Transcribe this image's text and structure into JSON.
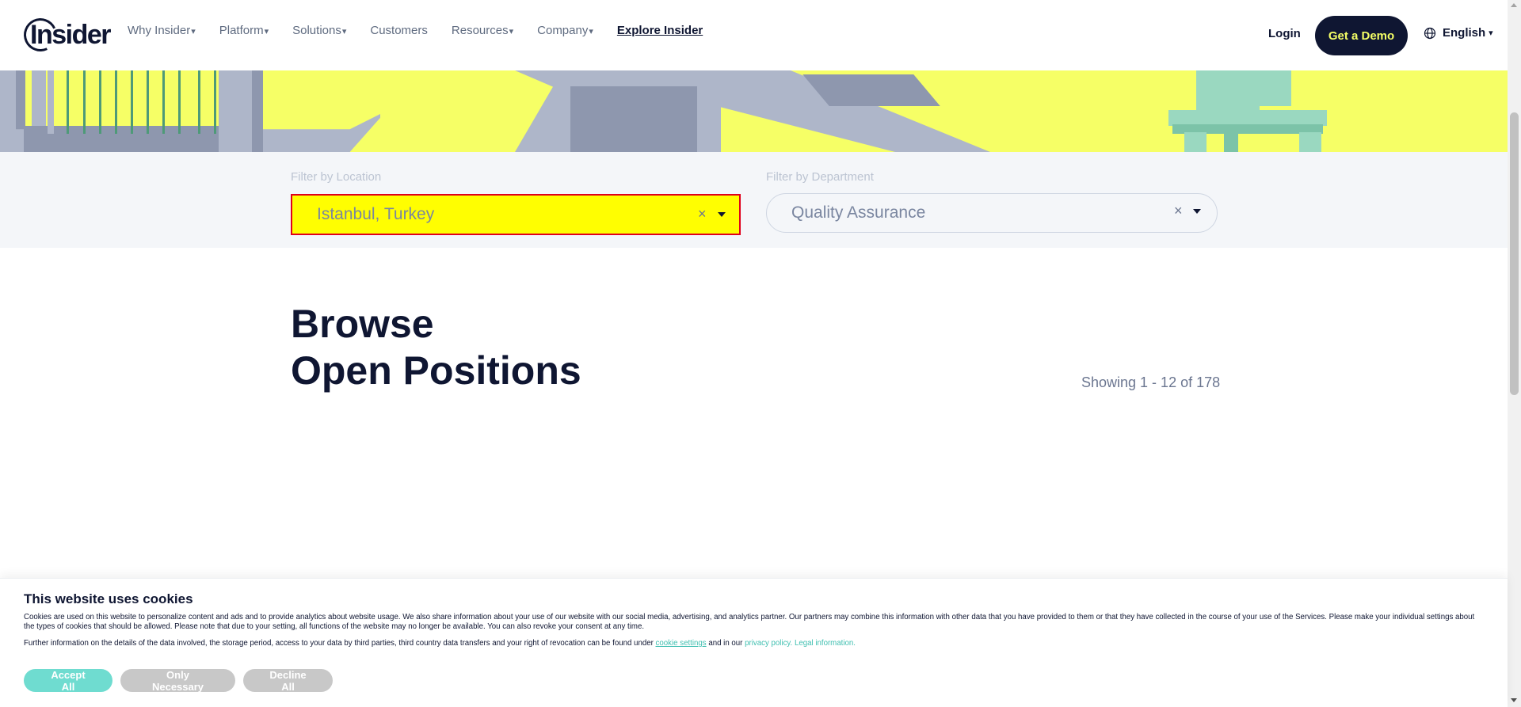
{
  "header": {
    "logo_text": "Insider",
    "nav": [
      {
        "label": "Why Insider",
        "caret": "▾",
        "name": "nav-why-insider"
      },
      {
        "label": "Platform",
        "caret": "▾",
        "name": "nav-platform"
      },
      {
        "label": "Solutions",
        "caret": "▾",
        "name": "nav-solutions"
      },
      {
        "label": "Customers",
        "caret": "",
        "name": "nav-customers"
      },
      {
        "label": "Resources",
        "caret": "▾",
        "name": "nav-resources"
      },
      {
        "label": "Company",
        "caret": "▾",
        "name": "nav-company"
      }
    ],
    "explore_label": "Explore Insider",
    "login_label": "Login",
    "demo_label": "Get a Demo",
    "language_label": "English",
    "language_caret": "▾",
    "icons": {
      "globe": "globe-icon"
    }
  },
  "filters": {
    "location_label": "Filter by Location",
    "location_value": "Istanbul, Turkey",
    "department_label": "Filter by Department",
    "department_value": "Quality Assurance",
    "clear_glyph": "×",
    "highlight_color": "#fffe01",
    "highlight_border": "#e0001b"
  },
  "positions": {
    "title_line1": "Browse",
    "title_line2": "Open Positions",
    "showing_text": "Showing 1 - 12 of 178"
  },
  "cookie": {
    "title": "This website uses cookies",
    "text1": "Cookies are used on this website to personalize content and ads and to provide analytics about website usage. We also share information about your use of our website with our social media, advertising, and analytics partner. Our partners may combine this information with other data that you have provided to them or that they have collected in the course of your use of the Services. Please make your individual settings about the types of cookies that should be allowed. Please note that due to your setting, all functions of the website may no longer be available. You can also revoke your consent at any time.",
    "text2_prefix": "Further information on the details of the data involved, the storage period, access to your data by third parties, third country data transfers and your right of revocation can be found under ",
    "settings_link": "cookie settings",
    "text2_middle": " and in our ",
    "privacy_link": "privacy policy.",
    "legal_link": "Legal information.",
    "accept_label": "Accept All",
    "necessary_label": "Only Necessary",
    "decline_label": "Decline All"
  },
  "colors": {
    "brand_navy": "#0f1632",
    "brand_yellow": "#f6ff66",
    "accent_teal": "#6fdcd0"
  }
}
